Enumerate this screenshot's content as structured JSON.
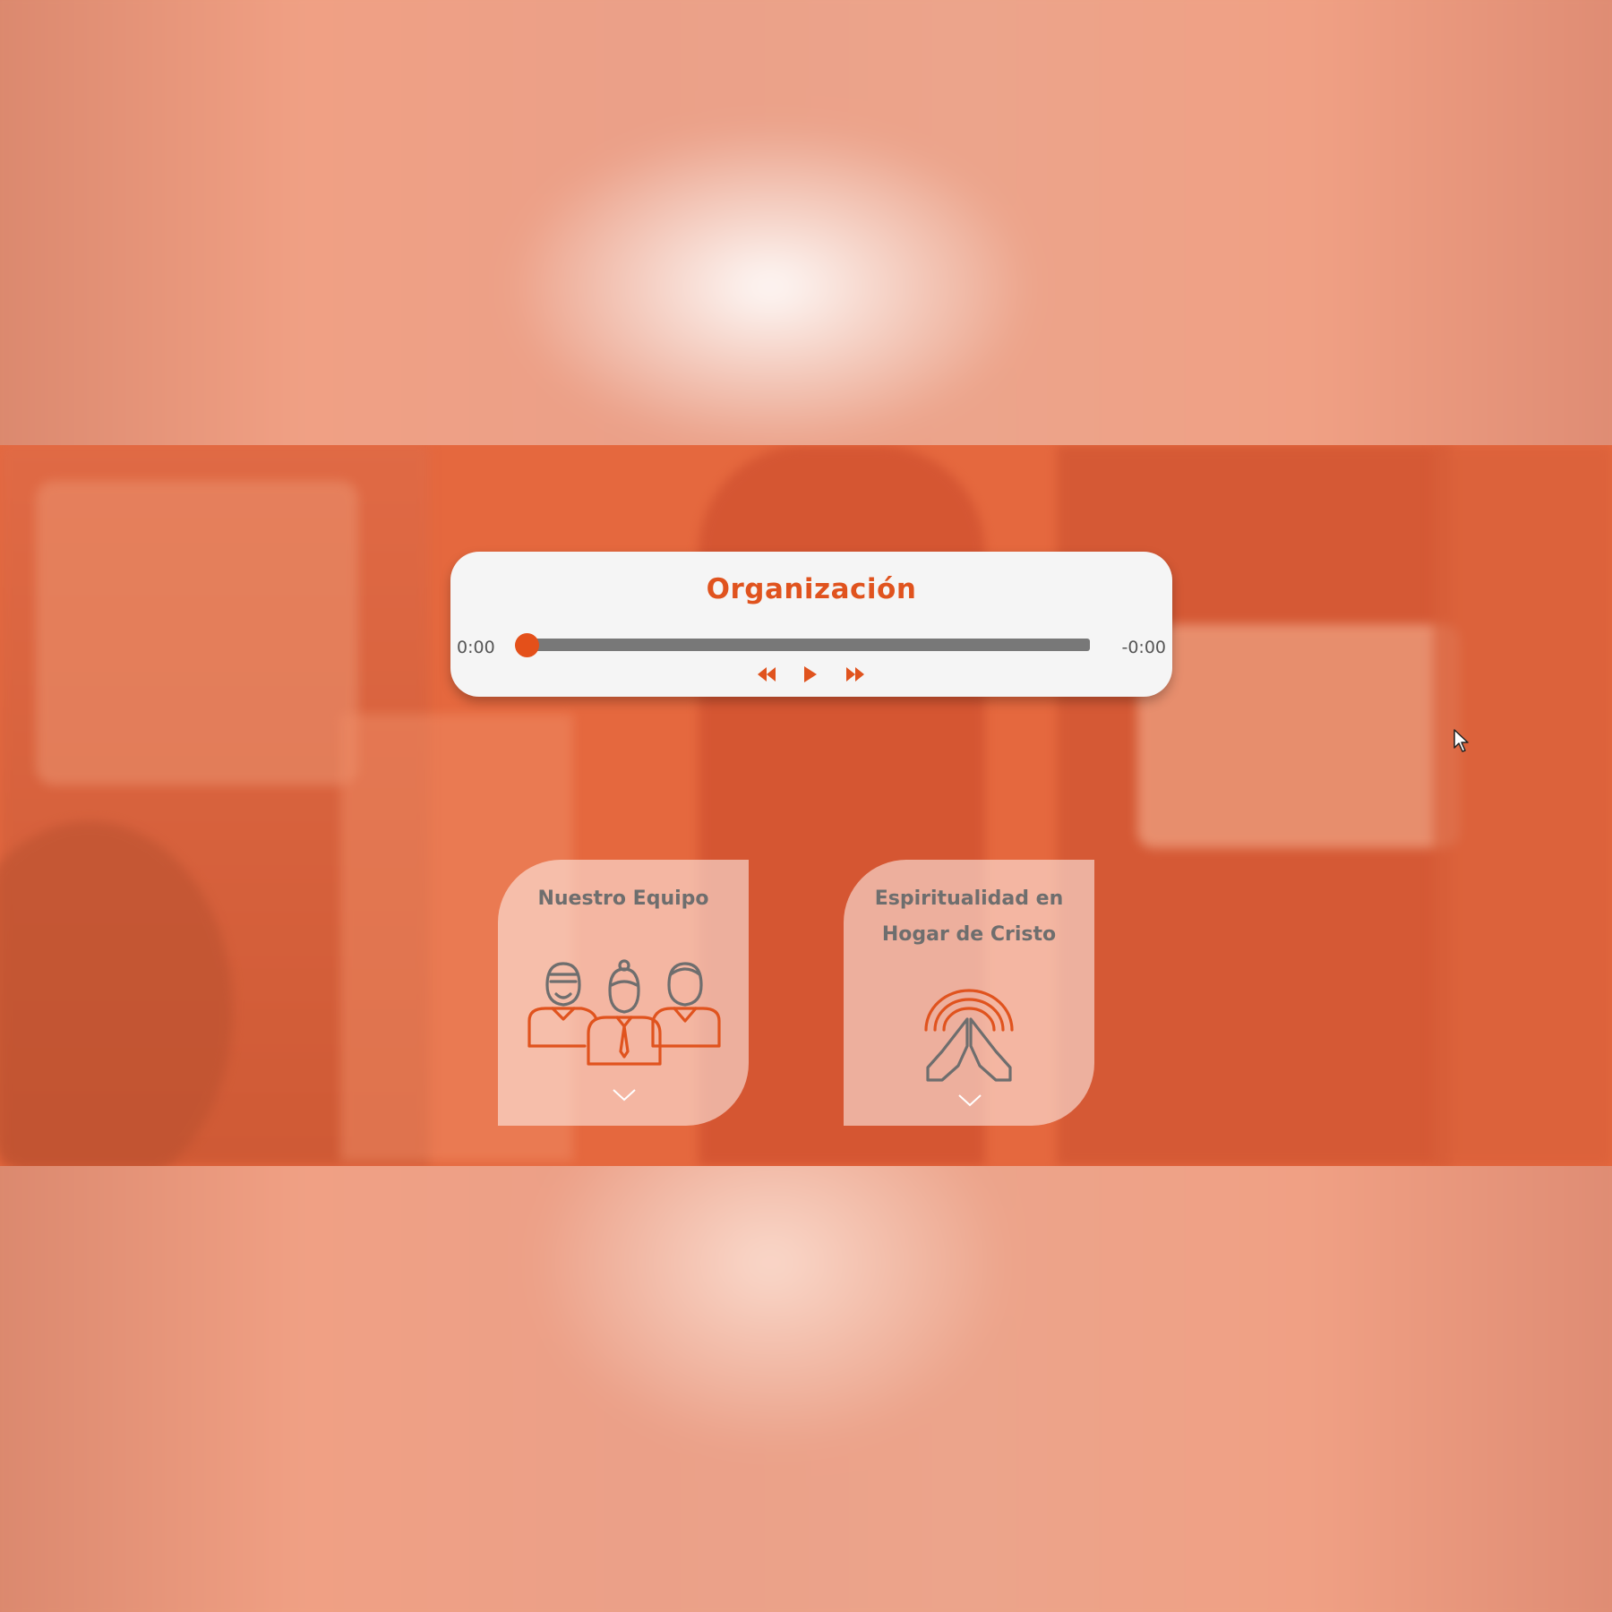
{
  "player": {
    "title": "Organización",
    "elapsed": "0:00",
    "remaining": "-0:00",
    "progress": 0,
    "controls": {
      "rewind_icon": "rewind-icon",
      "play_icon": "play-icon",
      "forward_icon": "fast-forward-icon"
    }
  },
  "cards": {
    "team": {
      "title": "Nuestro Equipo",
      "icon": "team-people-icon"
    },
    "spirit": {
      "title_line1": "Espiritualidad en",
      "title_line2": "Hogar de Cristo",
      "icon": "praying-hands-icon"
    }
  },
  "colors": {
    "accent": "#e0531e",
    "stage": "#e5683e",
    "player_bg": "#f5f5f5",
    "track": "#787878",
    "card_text": "#6e6e6e"
  }
}
